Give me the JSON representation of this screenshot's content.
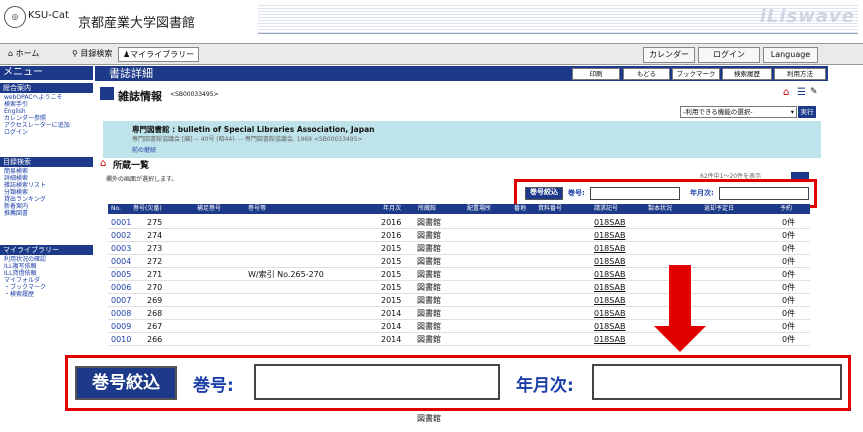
{
  "header": {
    "logo": "KSU-Cat",
    "library_name": "京都産業大学図書館",
    "brand": "iLiswave"
  },
  "navbar": {
    "home": "ホーム",
    "search": "目録検索",
    "mylibrary": "マイライブラリー",
    "calendar": "カレンダー",
    "login": "ログイン",
    "language": "Language"
  },
  "sidebar": {
    "menu_title": "メニュー",
    "sections": [
      {
        "title": "総合案内",
        "items": [
          "webOPACへようこそ",
          "検索手引",
          "English",
          "カレンダー参照",
          "アクセスレーターに追加",
          "ログイン"
        ]
      },
      {
        "title": "目録検索",
        "items": [
          "簡易検索",
          "詳細検索",
          "雑誌検索リスト",
          "分類検索",
          "貸出ランキング",
          "新着案内",
          "推薦図書"
        ]
      },
      {
        "title": "マイライブラリー",
        "items": [
          "利用状況の確認",
          "ILL複写依頼",
          "ILL貸借依頼",
          "マイフォルダ",
          "・ブックマーク",
          "・検索履歴"
        ]
      }
    ]
  },
  "main": {
    "title": "書誌詳細",
    "toolbar": [
      "印刷",
      "もどる",
      "ブックマーク",
      "検索履歴",
      "利用方法"
    ],
    "section_title": "雑誌情報",
    "record_id": "<SB00033495>",
    "function_select": "-利用できる機能の選択-",
    "go_button": "実行",
    "info": {
      "title": "専門図書館 : bulletin of Special Libraries Association, Japan",
      "sub": "専門図書館協議会 [編] -- 40号 (昭44)- -- 専門図書館協議会, 1969 <SB00033495>",
      "prev": "前の継続"
    },
    "holdings_title": "所蔵一覧",
    "holdings_note": "欄外の画面が選択します。",
    "count_text": "62件中1〜20件を表示",
    "filter": {
      "button": "巻号絞込",
      "vol_label": "巻号:",
      "date_label": "年月次:"
    },
    "table_headers": [
      "No.",
      "巻号(欠番)",
      "補足巻号",
      "巻号等",
      "年月次",
      "所蔵館",
      "配置場所",
      "番地",
      "資料番号",
      "請求記号",
      "製本状況",
      "返却予定日",
      "予約"
    ],
    "rows": [
      {
        "no": "0001",
        "vol": "275",
        "note": "",
        "year": "2016",
        "loc": "図書館",
        "call": "018SAB",
        "res": "0件"
      },
      {
        "no": "0002",
        "vol": "274",
        "note": "",
        "year": "2016",
        "loc": "図書館",
        "call": "018SAB",
        "res": "0件"
      },
      {
        "no": "0003",
        "vol": "273",
        "note": "",
        "year": "2015",
        "loc": "図書館",
        "call": "018SAB",
        "res": "0件"
      },
      {
        "no": "0004",
        "vol": "272",
        "note": "",
        "year": "2015",
        "loc": "図書館",
        "call": "018SAB",
        "res": "0件"
      },
      {
        "no": "0005",
        "vol": "271",
        "note": "W/索引 No.265-270",
        "year": "2015",
        "loc": "図書館",
        "call": "018SAB",
        "res": "0件"
      },
      {
        "no": "0006",
        "vol": "270",
        "note": "",
        "year": "2015",
        "loc": "図書館",
        "call": "018SAB",
        "res": "0件"
      },
      {
        "no": "0007",
        "vol": "269",
        "note": "",
        "year": "2015",
        "loc": "図書館",
        "call": "018SAB",
        "res": "0件"
      },
      {
        "no": "0008",
        "vol": "268",
        "note": "",
        "year": "2014",
        "loc": "図書館",
        "call": "018SAB",
        "res": "0件"
      },
      {
        "no": "0009",
        "vol": "267",
        "note": "",
        "year": "2014",
        "loc": "図書館",
        "call": "018SAB",
        "res": "0件"
      },
      {
        "no": "0010",
        "vol": "266",
        "note": "",
        "year": "2014",
        "loc": "図書館",
        "call": "018SAB",
        "res": "0件"
      }
    ],
    "cut_row_loc": "図書館"
  },
  "colors": {
    "navy": "#1d3a8a",
    "highlight": "#e00000",
    "info_bg": "#bfe3ea"
  }
}
